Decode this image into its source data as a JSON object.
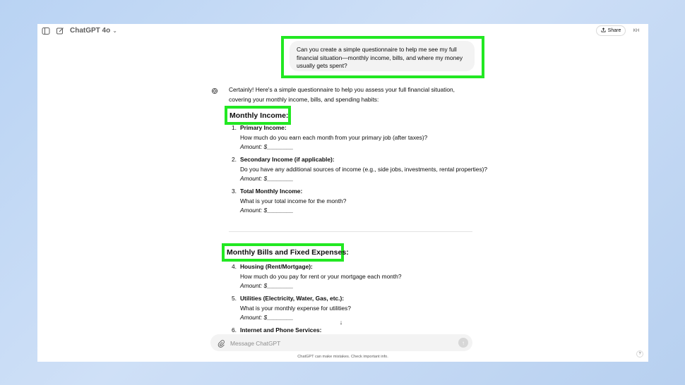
{
  "header": {
    "model_name": "ChatGPT 4o",
    "share_label": "Share",
    "avatar_initials": "KH"
  },
  "conversation": {
    "user_message": "Can you create a simple questionnaire to help me see my full financial situation—monthly income, bills, and where my money usually gets spent?",
    "assistant_intro": "Certainly! Here's a simple questionnaire to help you assess your full financial situation, covering your monthly income, bills, and spending habits:",
    "sections": [
      {
        "heading": "Monthly Income:",
        "items": [
          {
            "num": "1.",
            "title": "Primary Income:",
            "question": "How much do you earn each month from your primary job (after taxes)?",
            "amount": "Amount: $________"
          },
          {
            "num": "2.",
            "title": "Secondary Income (if applicable):",
            "question": "Do you have any additional sources of income (e.g., side jobs, investments, rental properties)?",
            "amount": "Amount: $________"
          },
          {
            "num": "3.",
            "title": "Total Monthly Income:",
            "question": "What is your total income for the month?",
            "amount": "Amount: $________"
          }
        ]
      },
      {
        "heading": "Monthly Bills and Fixed Expenses:",
        "items": [
          {
            "num": "4.",
            "title": "Housing (Rent/Mortgage):",
            "question": "How much do you pay for rent or your mortgage each month?",
            "amount": "Amount: $________"
          },
          {
            "num": "5.",
            "title": "Utilities (Electricity, Water, Gas, etc.):",
            "question": "What is your monthly expense for utilities?",
            "amount": "Amount: $________"
          },
          {
            "num": "6.",
            "title": "Internet and Phone Services:"
          }
        ]
      }
    ]
  },
  "composer": {
    "placeholder": "Message ChatGPT"
  },
  "footer": {
    "disclaimer": "ChatGPT can make mistakes. Check important info.",
    "help_label": "?"
  },
  "icons": {
    "sidebar_toggle": "sidebar-icon",
    "new_chat": "edit-icon",
    "share": "upload-icon",
    "assistant": "openai-logo-icon",
    "attach": "paperclip-icon",
    "send": "arrow-up-icon",
    "scroll_down": "arrow-down-icon"
  },
  "colors": {
    "highlight": "#22e822",
    "bubble": "#f3f3f3",
    "background": "#cfe0f7"
  }
}
